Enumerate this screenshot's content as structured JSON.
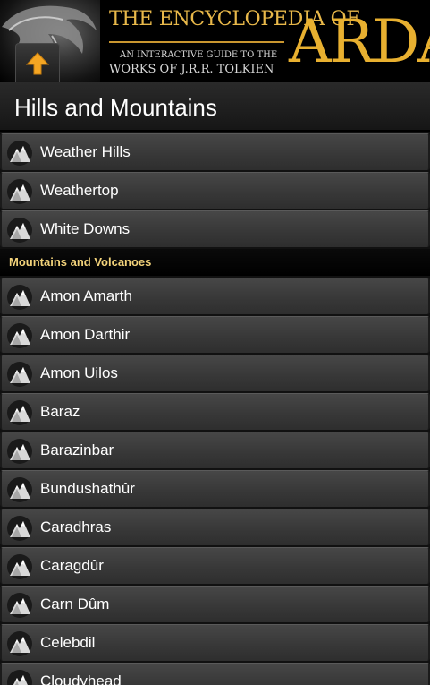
{
  "banner": {
    "title_top": "THE ENCYCLOPEDIA OF",
    "title_big": "ARDA",
    "subtitle_line1": "AN INTERACTIVE GUIDE TO THE",
    "subtitle_line2": "WORKS OF J.R.R. TOLKIEN",
    "up_icon": "up-arrow-icon",
    "accent_color": "#e8b030"
  },
  "header": {
    "title": "Hills and Mountains"
  },
  "list": {
    "group_top": [
      "Weather Hills",
      "Weathertop",
      "White Downs"
    ],
    "section_title": "Mountains and Volcanoes",
    "group_mountains": [
      "Amon Amarth",
      "Amon Darthir",
      "Amon Uilos",
      "Baraz",
      "Barazinbar",
      "Bundushathûr",
      "Caradhras",
      "Caragdûr",
      "Carn Dûm",
      "Celebdil",
      "Cloudyhead"
    ],
    "item_icon": "mountain-icon"
  }
}
